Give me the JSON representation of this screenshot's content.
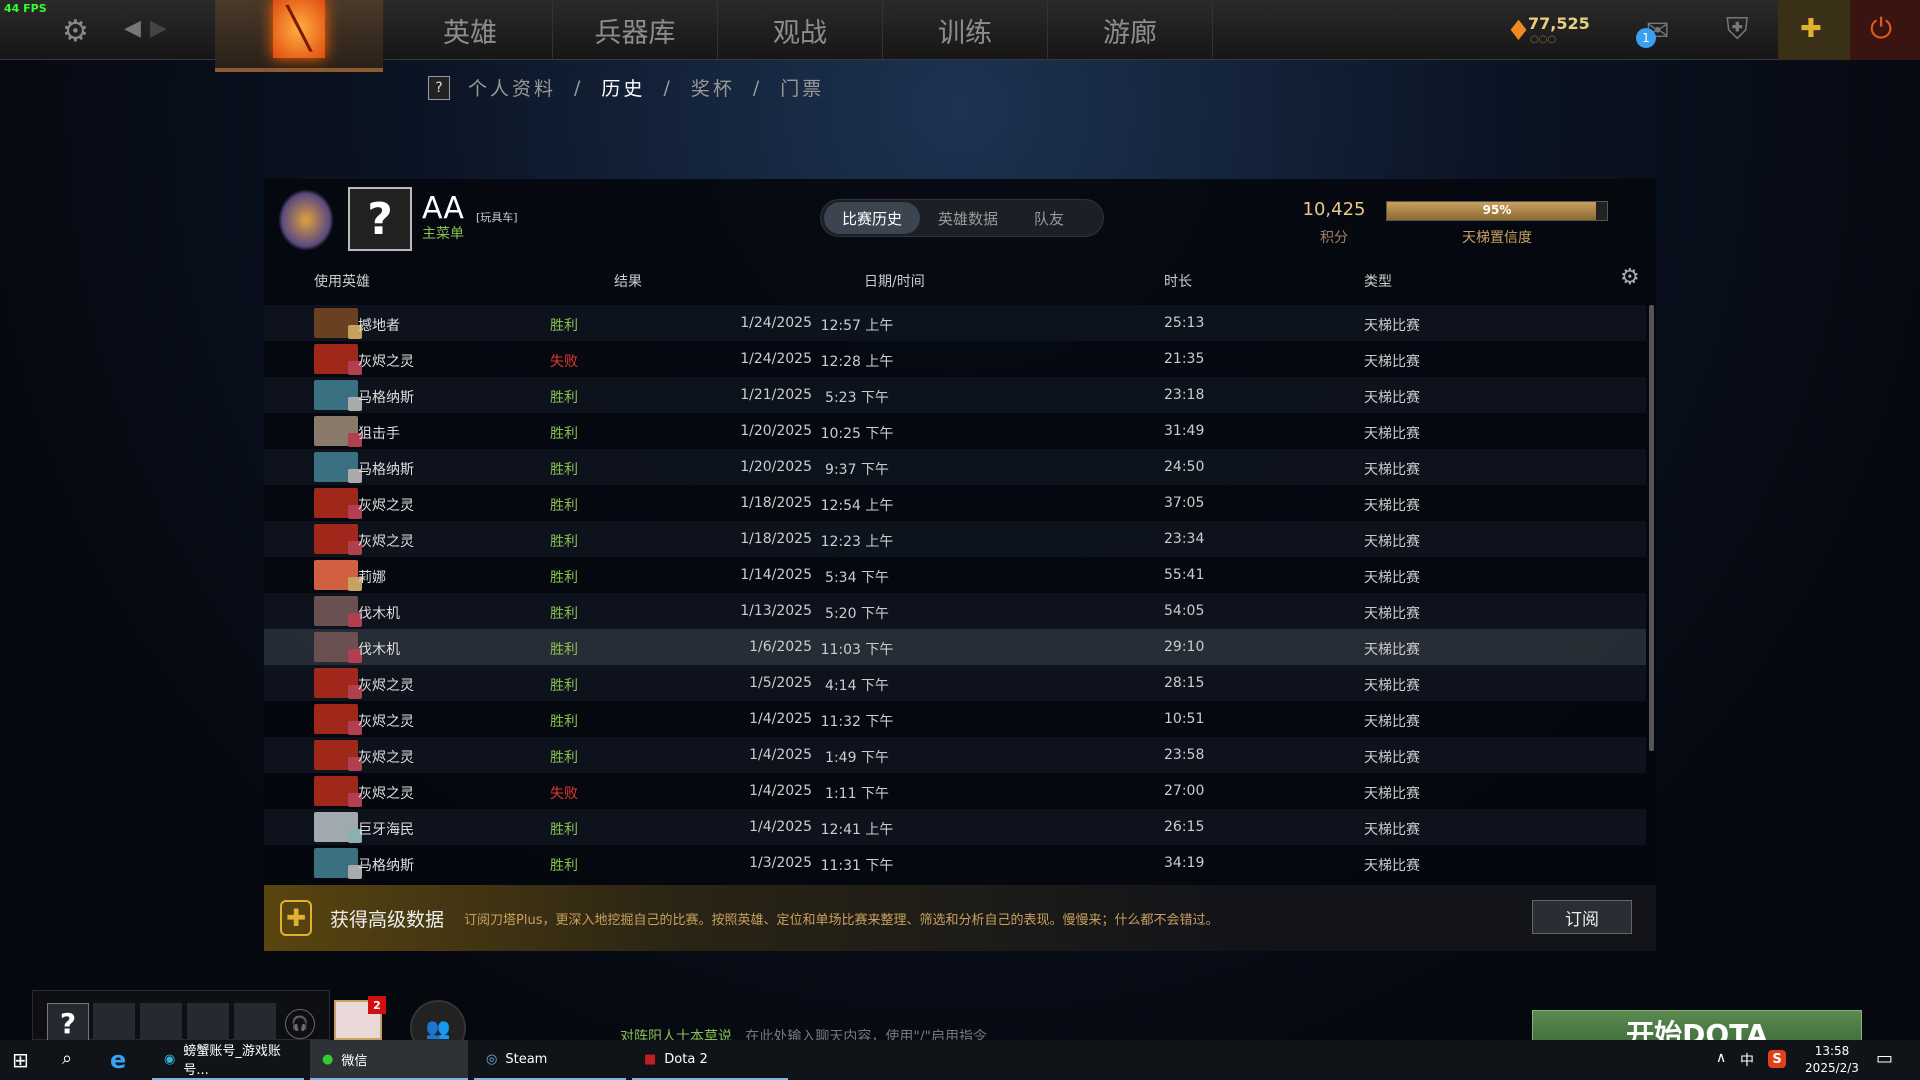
{
  "fps": "44 FPS",
  "topnav": {
    "items": [
      "英雄",
      "兵器库",
      "观战",
      "训练",
      "游廊"
    ],
    "currency": "77,525",
    "currency_sub": "○○○",
    "mail_count": "1"
  },
  "subnav": {
    "help": "?",
    "items": [
      "个人资料",
      "历史",
      "奖杯",
      "门票"
    ],
    "separator": "/"
  },
  "profile": {
    "avatar": "?",
    "name": "AA",
    "tag": "[玩具车]",
    "status": "主菜单",
    "score": "10,425",
    "score_label": "积分",
    "confidence": 95,
    "confidence_text": "95%",
    "confidence_label": "天梯置信度"
  },
  "tabs": [
    "比赛历史",
    "英雄数据",
    "队友"
  ],
  "columns": [
    "使用英雄",
    "结果",
    "日期/时间",
    "时长",
    "类型"
  ],
  "matches": [
    [
      "撼地者",
      "胜利",
      "1/24/2025",
      "12:57 上午",
      "25:13",
      "天梯比赛"
    ],
    [
      "灰烬之灵",
      "失败",
      "1/24/2025",
      "12:28 上午",
      "21:35",
      "天梯比赛"
    ],
    [
      "马格纳斯",
      "胜利",
      "1/21/2025",
      "5:23 下午",
      "23:18",
      "天梯比赛"
    ],
    [
      "狙击手",
      "胜利",
      "1/20/2025",
      "10:25 下午",
      "31:49",
      "天梯比赛"
    ],
    [
      "马格纳斯",
      "胜利",
      "1/20/2025",
      "9:37 下午",
      "24:50",
      "天梯比赛"
    ],
    [
      "灰烬之灵",
      "胜利",
      "1/18/2025",
      "12:54 上午",
      "37:05",
      "天梯比赛"
    ],
    [
      "灰烬之灵",
      "胜利",
      "1/18/2025",
      "12:23 上午",
      "23:34",
      "天梯比赛"
    ],
    [
      "莉娜",
      "胜利",
      "1/14/2025",
      "5:34 下午",
      "55:41",
      "天梯比赛"
    ],
    [
      "伐木机",
      "胜利",
      "1/13/2025",
      "5:20 下午",
      "54:05",
      "天梯比赛"
    ],
    [
      "伐木机",
      "胜利",
      "1/6/2025",
      "11:03 下午",
      "29:10",
      "天梯比赛"
    ],
    [
      "灰烬之灵",
      "胜利",
      "1/5/2025",
      "4:14 下午",
      "28:15",
      "天梯比赛"
    ],
    [
      "灰烬之灵",
      "胜利",
      "1/4/2025",
      "11:32 下午",
      "10:51",
      "天梯比赛"
    ],
    [
      "灰烬之灵",
      "胜利",
      "1/4/2025",
      "1:49 下午",
      "23:58",
      "天梯比赛"
    ],
    [
      "灰烬之灵",
      "失败",
      "1/4/2025",
      "1:11 下午",
      "27:00",
      "天梯比赛"
    ],
    [
      "巨牙海民",
      "胜利",
      "1/4/2025",
      "12:41 上午",
      "26:15",
      "天梯比赛"
    ],
    [
      "马格纳斯",
      "胜利",
      "1/3/2025",
      "11:31 下午",
      "34:19",
      "天梯比赛"
    ]
  ],
  "colors": {
    "win": "#8cbf50",
    "loss": "#e03a2a",
    "accent": "#c8a060"
  },
  "banner": {
    "title": "获得高级数据",
    "text": "订阅刀塔Plus，更深入地挖掘自己的比赛。按照英雄、定位和单场比赛来整理、筛选和分析自己的表现。慢慢来；什么都不会错过。",
    "button": "订阅"
  },
  "party": {
    "self": "?",
    "notif": "2"
  },
  "chat": {
    "channel": "对阵阳人士本草说",
    "placeholder": "在此处输入聊天内容，使用\"/\"启用指令"
  },
  "play_button": "开始DOTA",
  "taskbar": {
    "apps": [
      "螃蟹账号_游戏账号...",
      "微信",
      "Steam",
      "Dota 2"
    ],
    "ime": "中",
    "time": "13:58",
    "date": "2025/2/3"
  }
}
